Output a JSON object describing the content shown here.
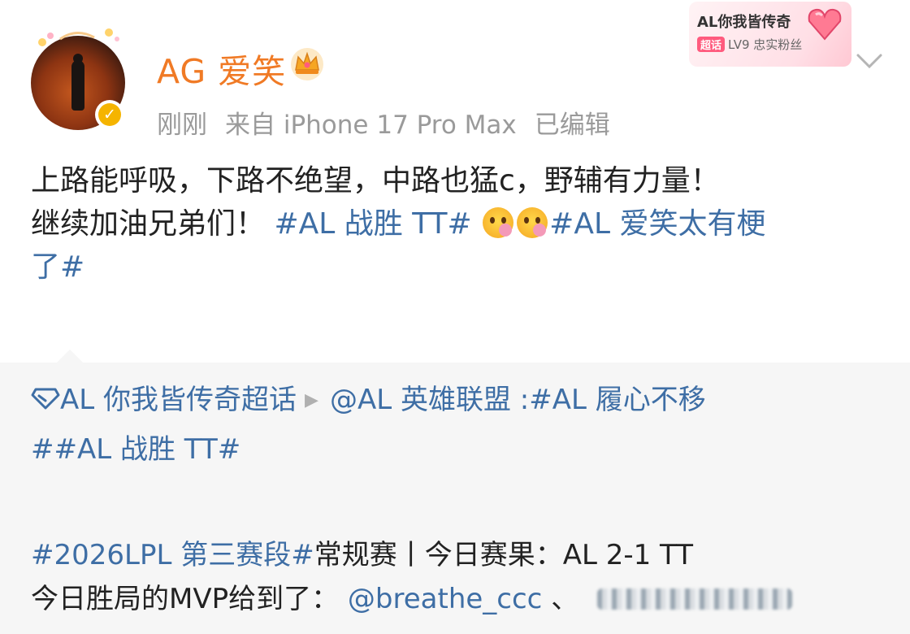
{
  "post": {
    "username": "AG 爱笑",
    "timestamp": "刚刚",
    "source": "来自 iPhone 17 Pro Max",
    "edited": "已编辑",
    "content_line1": "上路能呼吸，下路不绝望，中路也猛c，野辅有力量！",
    "content_line2_text": "继续加油兄弟们！",
    "hashtag1": "#AL 战胜 TT#",
    "hashtag2": "#AL 爱笑太有梗",
    "hashtag2_end": "了#",
    "icons": {
      "verified": "verified-badge-icon",
      "crown": "crown-icon",
      "more": "chevron-down-icon"
    }
  },
  "fan_badge": {
    "title": "AL你我皆传奇",
    "chip": "超话",
    "level": "LV9 忠实粉丝"
  },
  "repost": {
    "supertopic": "AL 你我皆传奇超话",
    "arrow": "▶",
    "mention": "@AL 英雄联盟",
    "colon_tag": " :#AL 履心不移",
    "line2": "##AL 战胜 TT#",
    "result_tag": "#2026LPL 第三赛段#",
    "result_text": "常规赛丨今日赛果：AL 2-1 TT",
    "mvp_text": "今日胜局的MVP给到了：",
    "mvp_user": "@breathe_ccc",
    "mvp_sep": "、"
  }
}
